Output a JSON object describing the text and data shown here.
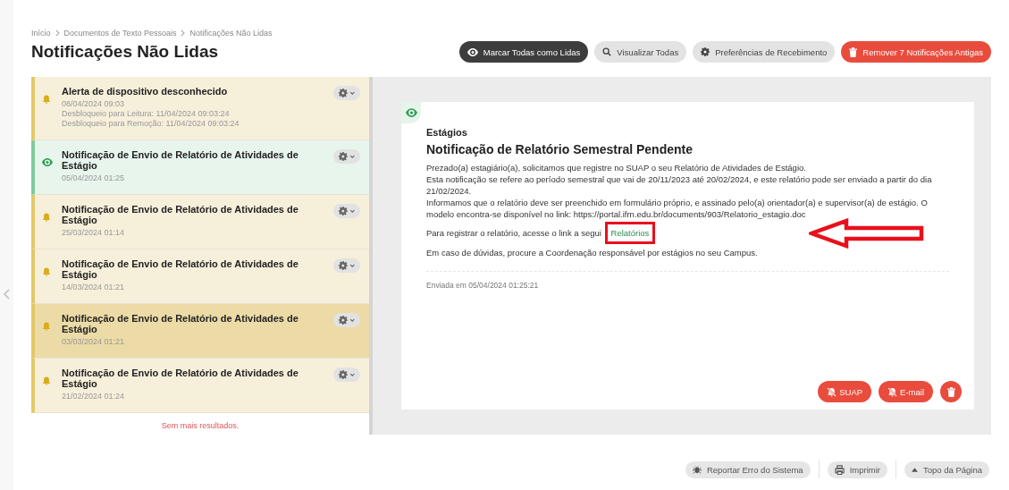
{
  "breadcrumb": [
    "Início",
    "Documentos de Texto Pessoais",
    "Notificações Não Lidas"
  ],
  "title": "Notificações Não Lidas",
  "actions": [
    {
      "label": "Marcar Todas como Lidas",
      "kind": "dark"
    },
    {
      "label": "Visualizar Todas",
      "kind": "light"
    },
    {
      "label": "Preferências de Recebimento",
      "kind": "light"
    },
    {
      "label": "Remover 7 Notificações Antigas",
      "kind": "danger"
    }
  ],
  "notifications": [
    {
      "title": "Alerta de dispositivo desconhecido",
      "date": "08/04/2024 09:03",
      "details": [
        "Desbloqueio para Leitura: 11/04/2024 09:03:24",
        "Desbloqueio para Remoção: 11/04/2024 09:03:24"
      ],
      "read": false,
      "highlighted": false
    },
    {
      "title": "Notificação de Envio de Relatório de Atividades de Estágio",
      "date": "05/04/2024 01:25",
      "read": true,
      "highlighted": false
    },
    {
      "title": "Notificação de Envio de Relatório de Atividades de Estágio",
      "date": "25/03/2024 01:14",
      "read": false,
      "highlighted": false
    },
    {
      "title": "Notificação de Envio de Relatório de Atividades de Estágio",
      "date": "14/03/2024 01:21",
      "read": false,
      "highlighted": false
    },
    {
      "title": "Notificação de Envio de Relatório de Atividades de Estágio",
      "date": "03/03/2024 01:21",
      "read": false,
      "highlighted": true
    },
    {
      "title": "Notificação de Envio de Relatório de Atividades de Estágio",
      "date": "21/02/2024 01:24",
      "read": false,
      "highlighted": false
    }
  ],
  "list_end": "Sem mais resultados.",
  "detail": {
    "category": "Estágios",
    "title": "Notificação de Relatório Semestral Pendente",
    "paragraphs": [
      "Prezado(a) estagiário(a), solicitamos que registre no SUAP o seu Relatório de Atividades de Estágio.",
      "Esta notificação se refere ao período semestral que vai de 20/11/2023 até 20/02/2024, e este relatório pode ser enviado a partir do dia 21/02/2024.",
      "Informamos que o relatório deve ser preenchido em formulário próprio, e assinado pelo(a) orientador(a) e supervisor(a) de estágio. O modelo encontra-se disponível no link: https://portal.ifrn.edu.br/documents/903/Relatorio_estagio.doc"
    ],
    "link_intro": "Para registrar o relatório, acesse o link a segui",
    "link": "Relatórios",
    "closing": "Em caso de dúvidas, procure a Coordenação responsável por estágios no seu Campus.",
    "sent": "Enviada em 05/04/2024 01:25:21",
    "buttons": [
      {
        "label": "SUAP",
        "kind": "mute"
      },
      {
        "label": "E-mail",
        "kind": "mute"
      },
      {
        "kind": "delete"
      }
    ]
  },
  "footer": [
    {
      "label": "Reportar Erro do Sistema"
    },
    {
      "label": "Imprimir"
    },
    {
      "label": "Topo da Página"
    }
  ]
}
